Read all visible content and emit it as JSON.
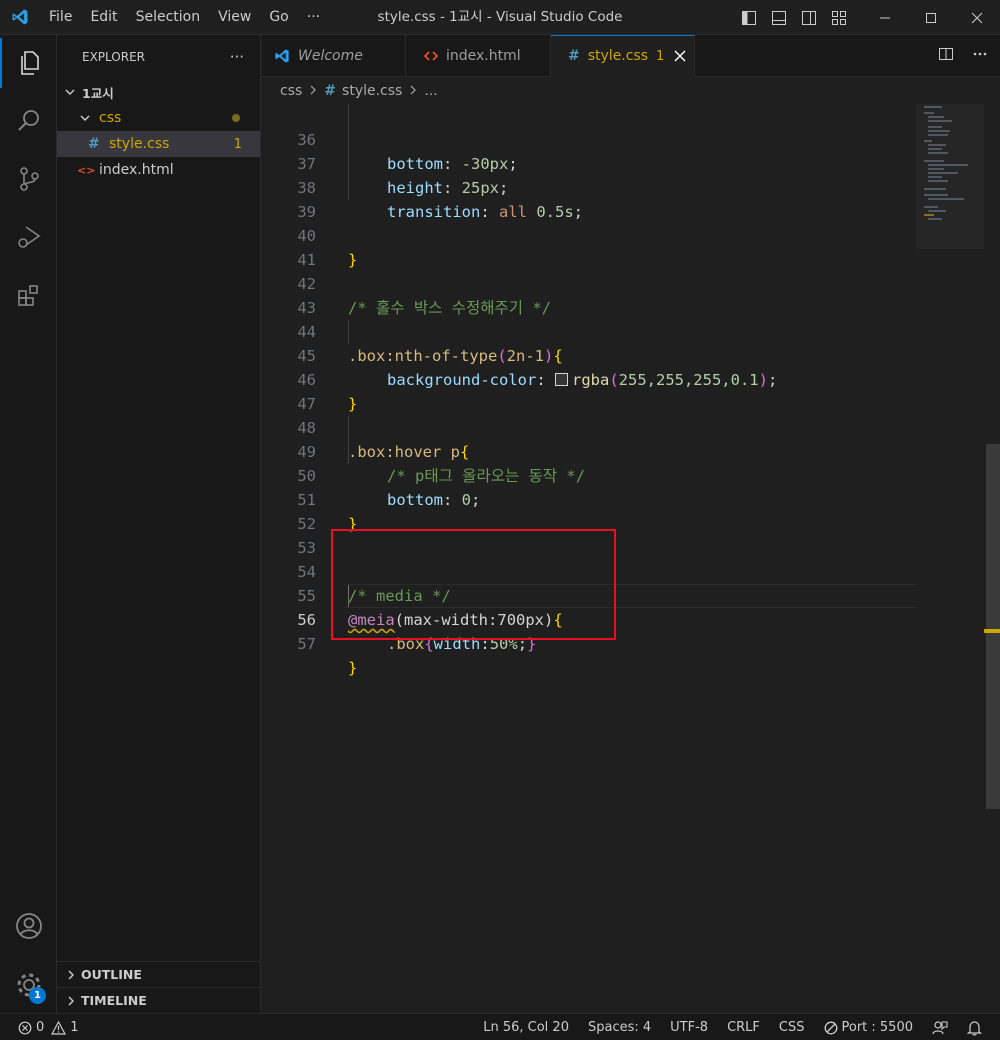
{
  "window": {
    "title": "style.css - 1교시 - Visual Studio Code"
  },
  "menu": [
    "File",
    "Edit",
    "Selection",
    "View",
    "Go",
    "···"
  ],
  "explorer": {
    "header": "EXPLORER",
    "more": "···",
    "root": "1교시",
    "folder": "css",
    "files": [
      {
        "name": "style.css",
        "badge": "1",
        "icon": "#"
      },
      {
        "name": "index.html",
        "icon": "<>"
      }
    ],
    "outline": "OUTLINE",
    "timeline": "TIMELINE"
  },
  "tabs": [
    {
      "label": "Welcome",
      "icon": "vscode-icon"
    },
    {
      "label": "index.html",
      "icon": "html-icon"
    },
    {
      "label": "style.css",
      "badge": "1",
      "icon": "#"
    }
  ],
  "breadcrumb": {
    "folder": "css",
    "file": "style.css",
    "rest": "...",
    "hash": "#"
  },
  "editor": {
    "line_numbers": [
      "36",
      "37",
      "38",
      "39",
      "40",
      "41",
      "42",
      "43",
      "44",
      "45",
      "46",
      "47",
      "48",
      "49",
      "50",
      "51",
      "52",
      "53",
      "54",
      "55",
      "56",
      "57"
    ],
    "current_line": "56",
    "code": {
      "l36_prop": "bottom",
      "l36_colon": ": ",
      "l36_val": "-30px",
      "l36_semi": ";",
      "l37_prop": "height",
      "l37_colon": ": ",
      "l37_val": "25px",
      "l37_semi": ";",
      "l38_prop": "transition",
      "l38_colon": ": ",
      "l38_kw": "all",
      "l38_val": " 0.5s",
      "l38_semi": ";",
      "l40": "}",
      "l42": "/* 홀수 박스 수정해주기 */",
      "l44_sel": ".box:nth-of-type",
      "l44_p1": "(",
      "l44_arg": "2n-1",
      "l44_p2": ")",
      "l44_b": "{",
      "l45_prop": "background-color",
      "l45_colon": ": ",
      "l45_fn": "rgba",
      "l45_p1": "(",
      "l45_args": "255,255,255,0.1",
      "l45_p2": ")",
      "l45_semi": ";",
      "l46": "}",
      "l48_sel": ".box:hover p",
      "l48_b": "{",
      "l49": "/* p태그 올라오는 동작 */",
      "l50_prop": "bottom",
      "l50_colon": ": ",
      "l50_val": "0",
      "l50_semi": ";",
      "l51": "}",
      "l54": "/* media */",
      "l55_at": "@meia",
      "l55_p1": "(",
      "l55_feat": "max-width",
      "l55_colon": ":",
      "l55_val": "700px",
      "l55_p2": ")",
      "l55_b": "{",
      "l56_sel": ".box",
      "l56_b1": "{",
      "l56_prop": "width",
      "l56_colon": ":",
      "l56_val": "50%",
      "l56_semi": ";",
      "l56_b2": "}",
      "l57": "}"
    }
  },
  "status": {
    "errors": "0",
    "warnings": "1",
    "position": "Ln 56, Col 20",
    "spaces": "Spaces: 4",
    "encoding": "UTF-8",
    "eol": "CRLF",
    "language": "CSS",
    "port": "Port : 5500"
  },
  "accounts_badge": "1",
  "colors": {
    "accent": "#0078d4",
    "highlight_box": "#e81123",
    "warning": "#cca700"
  }
}
